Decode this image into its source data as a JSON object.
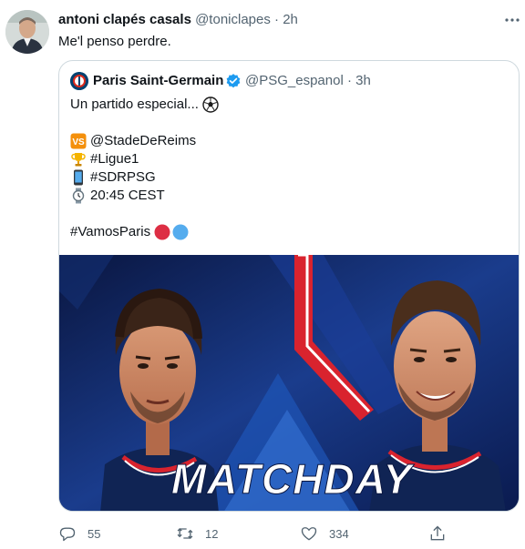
{
  "tweet": {
    "author_name": "antoni clapés casals",
    "author_handle": "@toniclapes",
    "separator": "·",
    "time": "2h",
    "text": "Me'l penso perdre.",
    "more_icon": "more-dots-icon"
  },
  "quoted": {
    "author_name": "Paris Saint-Germain",
    "author_handle": "@PSG_espanol",
    "separator": "·",
    "time": "3h",
    "text_lines": [
      "Un partido especial...",
      "@StadeDeReims",
      "#Ligue1",
      "#SDRPSG",
      "20:45 CEST",
      "#VamosParis"
    ],
    "emoji_icons": [
      "soccer-ball-icon",
      "vs-icon",
      "trophy-icon",
      "mobile-phone-icon",
      "watch-icon",
      "red-circle-icon",
      "blue-circle-icon"
    ],
    "image": {
      "overlay_text": "MATCHDAY",
      "colors": {
        "navy": "#0d1b4a",
        "blue": "#1e4fa8",
        "red": "#d9232e"
      }
    }
  },
  "actions": {
    "reply_count": "55",
    "retweet_count": "12",
    "like_count": "334"
  },
  "colors": {
    "text": "#0f1419",
    "muted": "#536471",
    "border": "#cfd9de",
    "verified": "#1d9bf0"
  }
}
